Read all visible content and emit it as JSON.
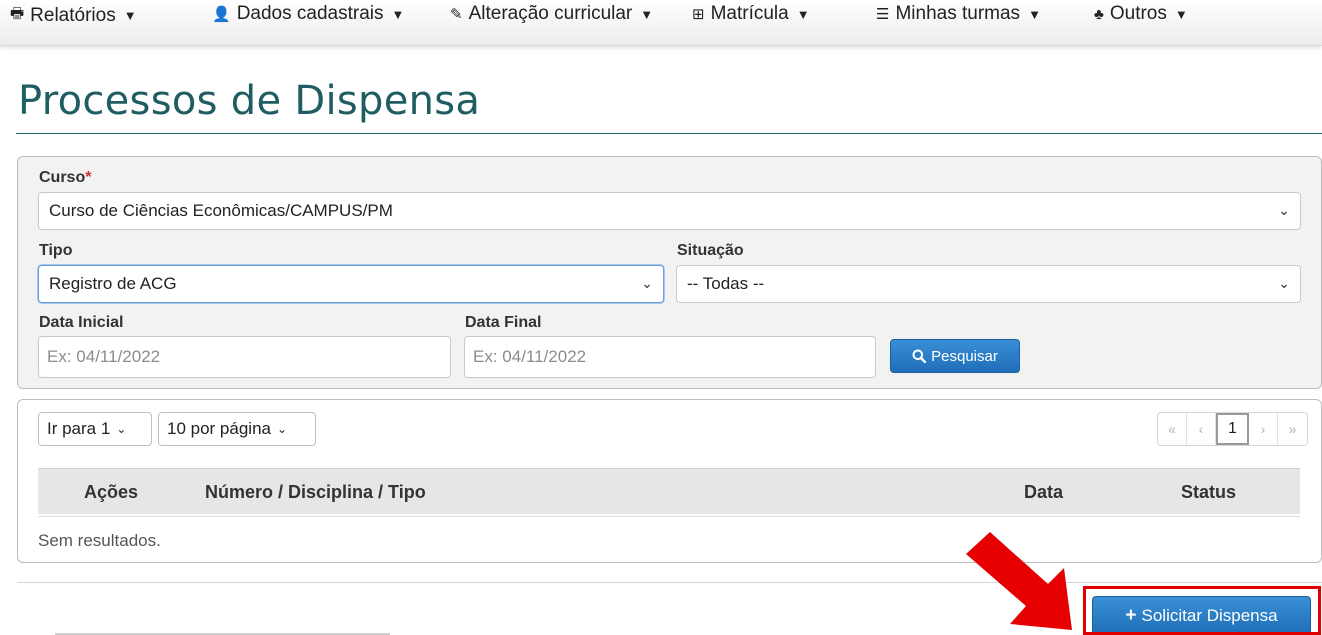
{
  "nav": {
    "items": [
      {
        "label": "Relatórios",
        "icon": "printer-icon",
        "glyph": "🖶"
      },
      {
        "label": "Dados cadastrais",
        "icon": "user-icon",
        "glyph": "👤"
      },
      {
        "label": "Alteração curricular",
        "icon": "edit-icon",
        "glyph": "✎"
      },
      {
        "label": "Matrícula",
        "icon": "table-icon",
        "glyph": "⊞"
      },
      {
        "label": "Minhas turmas",
        "icon": "list-icon",
        "glyph": "☰"
      },
      {
        "label": "Outros",
        "icon": "sitemap-icon",
        "glyph": "♣"
      }
    ]
  },
  "page": {
    "title": "Processos de Dispensa"
  },
  "filters": {
    "curso_label": "Curso",
    "curso_required": "*",
    "curso_value": "Curso de Ciências Econômicas/CAMPUS/PM",
    "tipo_label": "Tipo",
    "tipo_value": "Registro de ACG",
    "situacao_label": "Situação",
    "situacao_value": "-- Todas --",
    "data_inicial_label": "Data Inicial",
    "data_inicial_placeholder": "Ex: 04/11/2022",
    "data_final_label": "Data Final",
    "data_final_placeholder": "Ex: 04/11/2022",
    "search_button": "Pesquisar"
  },
  "results": {
    "goto_page": "Ir para 1",
    "per_page": "10 por página",
    "pager": {
      "first": "«",
      "prev": "‹",
      "current": "1",
      "next": "›",
      "last": "»"
    },
    "columns": [
      "Ações",
      "Número / Disciplina / Tipo",
      "Data",
      "Status"
    ],
    "empty_message": "Sem resultados."
  },
  "actions": {
    "request_button": "Solicitar Dispensa"
  },
  "colors": {
    "title": "#1f5d62",
    "primary": "#1e6fb8",
    "highlight": "#e00000"
  }
}
